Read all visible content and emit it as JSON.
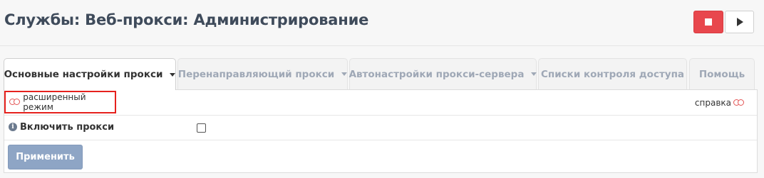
{
  "header": {
    "title": "Службы: Веб-прокси: Администрирование",
    "stop_icon": "stop-icon",
    "play_icon": "play-icon",
    "colors": {
      "stop": "#e8474d"
    }
  },
  "tabs": [
    {
      "label": "Основные настройки прокси",
      "active": true,
      "has_dropdown": true
    },
    {
      "label": "Перенаправляющий прокси",
      "active": false,
      "has_dropdown": true
    },
    {
      "label": "Автонастройки прокси-сервера",
      "active": false,
      "has_dropdown": true
    },
    {
      "label": "Списки контроля доступа",
      "active": false,
      "has_dropdown": false
    },
    {
      "label": "Помощь",
      "active": false,
      "has_dropdown": false
    }
  ],
  "form": {
    "advanced_mode_label": "расширенный режим",
    "help_label": "справка",
    "enable_proxy_label": "Включить прокси",
    "enable_proxy_checked": false,
    "apply_label": "Применить"
  }
}
